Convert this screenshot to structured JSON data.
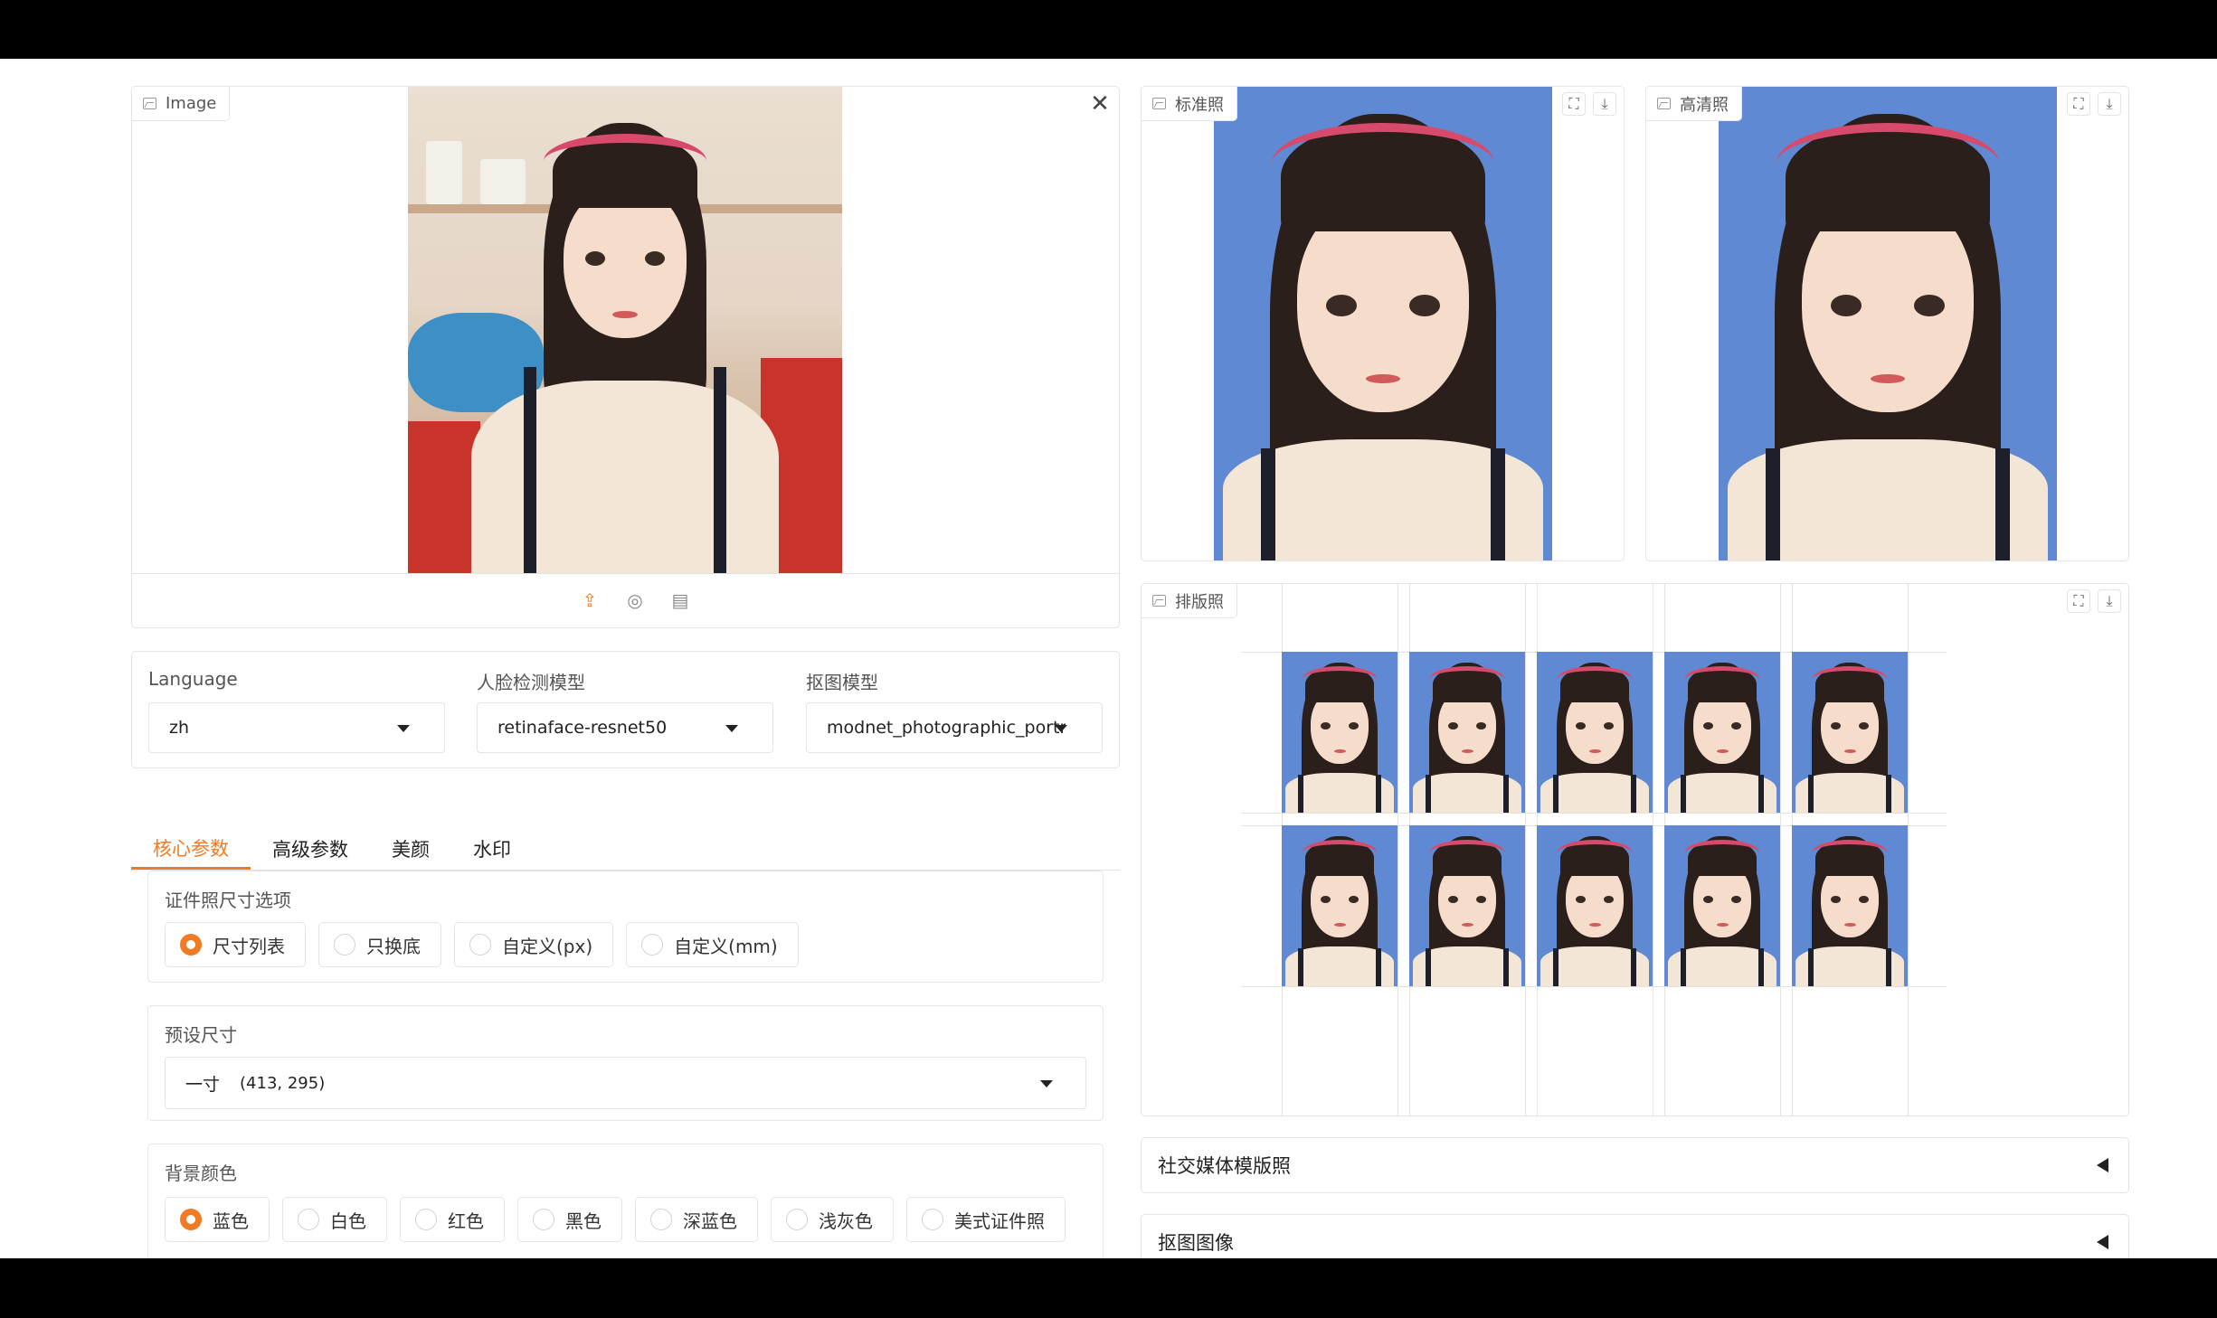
{
  "input_image": {
    "label": "Image"
  },
  "outputs": {
    "standard": {
      "label": "标准照"
    },
    "hd": {
      "label": "高清照"
    },
    "layout": {
      "label": "排版照"
    }
  },
  "selectors": {
    "language": {
      "label": "Language",
      "value": "zh"
    },
    "face_model": {
      "label": "人脸检测模型",
      "value": "retinaface-resnet50"
    },
    "matting_model": {
      "label": "抠图模型",
      "value": "modnet_photographic_portrait"
    }
  },
  "tabs": [
    {
      "label": "核心参数"
    },
    {
      "label": "高级参数"
    },
    {
      "label": "美颜"
    },
    {
      "label": "水印"
    }
  ],
  "size_options": {
    "label": "证件照尺寸选项",
    "options": [
      "尺寸列表",
      "只换底",
      "自定义(px)",
      "自定义(mm)"
    ],
    "selected": "尺寸列表"
  },
  "preset_size": {
    "label": "预设尺寸",
    "value_name": "一寸",
    "value_dims": "(413, 295)"
  },
  "background_color": {
    "label": "背景颜色",
    "options": [
      "蓝色",
      "白色",
      "红色",
      "黑色",
      "深蓝色",
      "浅灰色",
      "美式证件照"
    ],
    "selected": "蓝色"
  },
  "accordions": {
    "social": "社交媒体模版照",
    "matting": "抠图图像"
  },
  "colors": {
    "accent": "#f07b22",
    "photo_bg_blue": "#5f89d2"
  },
  "icons": [
    "image-icon",
    "close-icon",
    "fullscreen-icon",
    "download-icon",
    "upload-icon",
    "webcam-icon",
    "clipboard-icon",
    "chevron-down-icon",
    "triangle-left-icon"
  ]
}
